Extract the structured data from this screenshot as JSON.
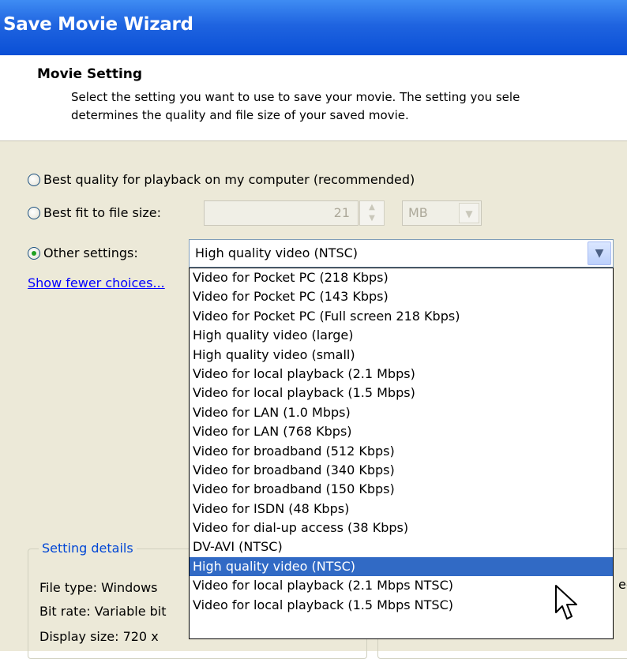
{
  "window": {
    "title": "Save Movie Wizard"
  },
  "header": {
    "title": "Movie Setting",
    "description_line1": "Select the setting you want to use to save your movie. The setting you sele",
    "description_line2": "determines the quality and file size of your saved movie."
  },
  "options": {
    "best_quality_label": "Best quality for playback on my computer (recommended)",
    "best_fit_label": "Best fit to file size:",
    "best_fit_value": "21",
    "best_fit_unit": "MB",
    "other_settings_label": "Other settings:",
    "selected_index": 2,
    "other_settings_value": "High quality video (NTSC)"
  },
  "show_fewer_link": "Show fewer choices...",
  "dropdown": {
    "items": [
      "Video for Pocket PC (218 Kbps)",
      "Video for Pocket PC (143 Kbps)",
      "Video for Pocket PC (Full screen 218 Kbps)",
      "High quality video (large)",
      "High quality video (small)",
      "Video for local playback (2.1 Mbps)",
      "Video for local playback (1.5 Mbps)",
      "Video for LAN (1.0 Mbps)",
      "Video for LAN (768 Kbps)",
      "Video for broadband (512 Kbps)",
      "Video for broadband (340 Kbps)",
      "Video for broadband (150 Kbps)",
      "Video for ISDN (48 Kbps)",
      "Video for dial-up access (38 Kbps)",
      "DV-AVI (NTSC)",
      "High quality video (NTSC)",
      "Video for local playback (2.1 Mbps NTSC)",
      "Video for local playback (1.5 Mbps NTSC)"
    ],
    "highlighted": "High quality video (NTSC)"
  },
  "setting_details": {
    "title": "Setting details",
    "file_type": "File type: Windows",
    "bit_rate": "Bit rate: Variable bit",
    "display_size": "Display size: 720 x"
  },
  "right_panel": {
    "partial_text": "ec"
  },
  "colors": {
    "titlebar": "#0a4fd6",
    "selection": "#316ac5",
    "link": "#0000ff",
    "body": "#ece9d8"
  }
}
